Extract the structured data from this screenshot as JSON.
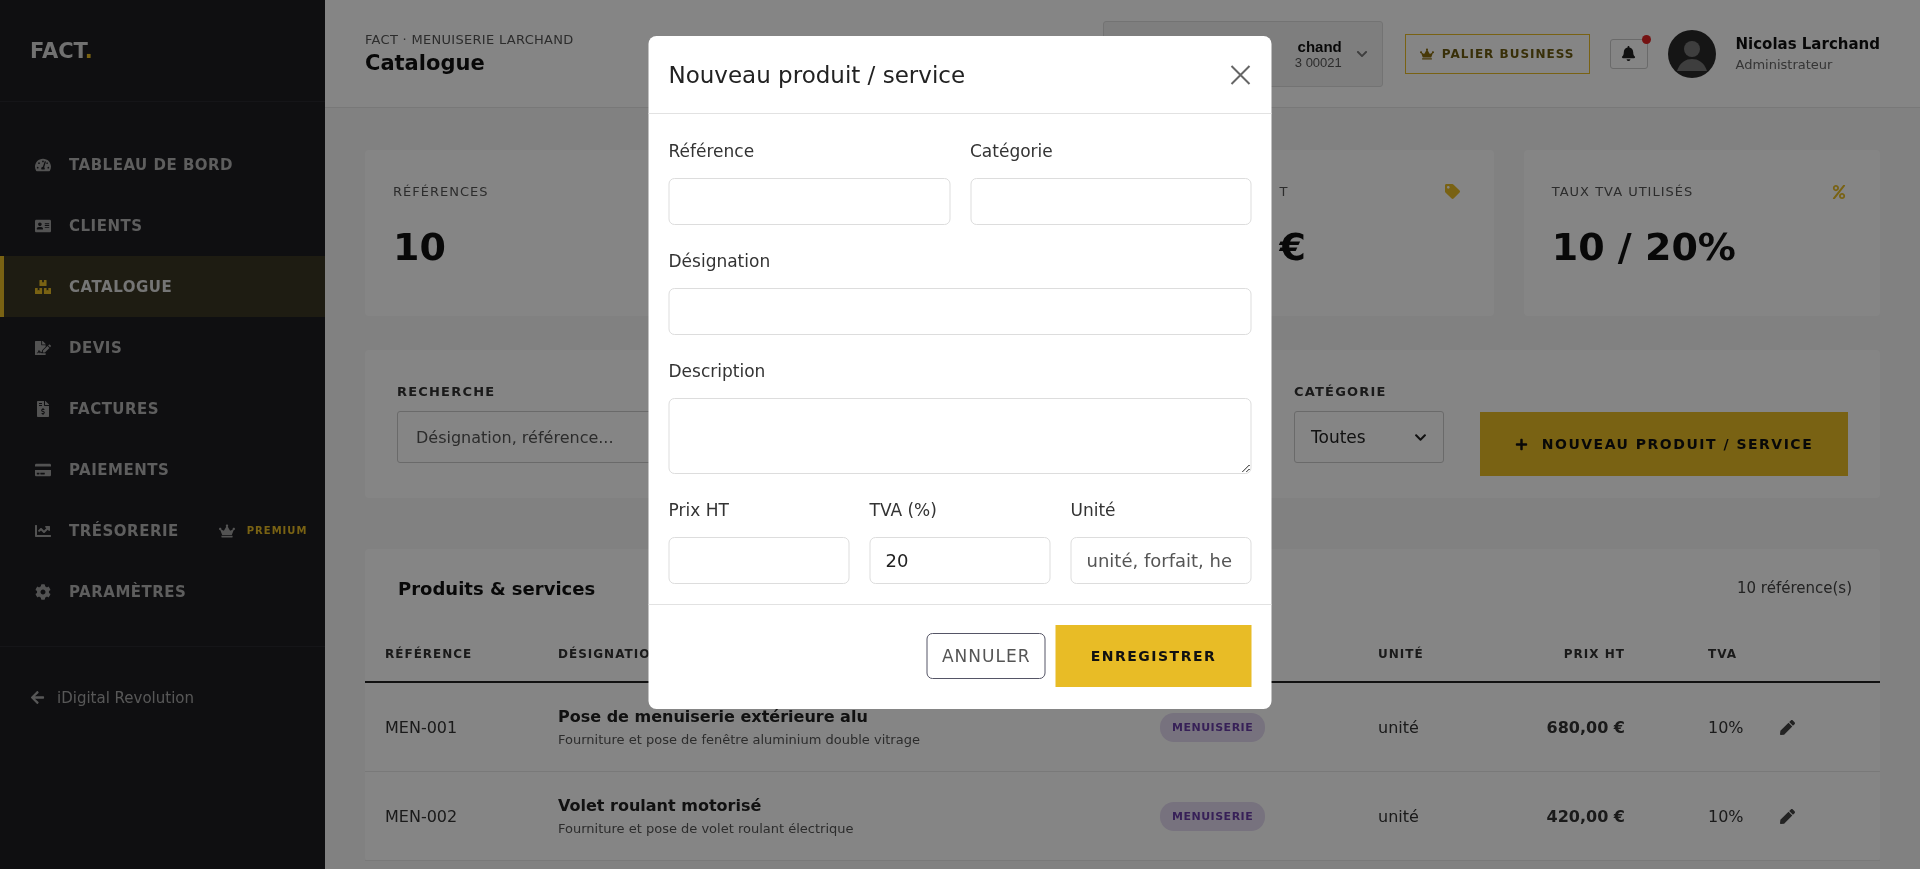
{
  "sidebar": {
    "logo": {
      "text": "FACT",
      "accent": "."
    },
    "items": [
      {
        "label": "TABLEAU DE BORD",
        "selected": false
      },
      {
        "label": "CLIENTS",
        "selected": false
      },
      {
        "label": "CATALOGUE",
        "selected": true
      },
      {
        "label": "DEVIS",
        "selected": false
      },
      {
        "label": "FACTURES",
        "selected": false
      },
      {
        "label": "PAIEMENTS",
        "selected": false
      },
      {
        "label": "TRÉSORERIE",
        "selected": false,
        "badge": "PREMIUM"
      },
      {
        "label": "PARAMÈTRES",
        "selected": false
      }
    ],
    "footer_link": "iDigital Revolution"
  },
  "header": {
    "breadcrumb": "FACT · MENUISERIE LARCHAND",
    "title": "Catalogue",
    "company_selector": {
      "name": "chand",
      "number": "3 00021"
    },
    "plan_badge": "PALIER BUSINESS",
    "notifications": {
      "unread": true
    },
    "user": {
      "name": "Nicolas Larchand",
      "role": "Administrateur"
    }
  },
  "stats": [
    {
      "kind": "plain",
      "label": "RÉFÉRENCES",
      "value": "10"
    },
    {
      "kind": "tagged",
      "label": "T",
      "value": "€"
    },
    {
      "kind": "rate",
      "label": "TAUX TVA UTILISÉS",
      "value": "10 / 20%"
    }
  ],
  "filters": {
    "search": {
      "label": "RECHERCHE",
      "placeholder": "Désignation, référence..."
    },
    "category": {
      "label": "CATÉGORIE",
      "value": "Toutes"
    },
    "new_button": "NOUVEAU PRODUIT / SERVICE"
  },
  "table": {
    "title": "Produits & services",
    "count": "10 référence(s)",
    "columns": [
      "RÉFÉRENCE",
      "DÉSIGNATIO",
      "UNITÉ",
      "PRIX HT",
      "TVA"
    ],
    "rows": [
      {
        "reference": "MEN-001",
        "title": "Pose de menuiserie extérieure alu",
        "description": "Fourniture et pose de fenêtre aluminium double vitrage",
        "category": "MENUISERIE",
        "unit": "unité",
        "price": "680,00 €",
        "vat": "10%"
      },
      {
        "reference": "MEN-002",
        "title": "Volet roulant motorisé",
        "description": "Fourniture et pose de volet roulant électrique",
        "category": "MENUISERIE",
        "unit": "unité",
        "price": "420,00 €",
        "vat": "10%"
      }
    ]
  },
  "modal": {
    "title": "Nouveau produit / service",
    "rows": [
      {
        "fields": [
          {
            "kind": "input",
            "label": "Référence"
          },
          {
            "kind": "input",
            "label": "Catégorie"
          }
        ]
      },
      {
        "fields": [
          {
            "kind": "input",
            "label": "Désignation"
          }
        ]
      },
      {
        "fields": [
          {
            "kind": "textarea",
            "label": "Description"
          }
        ]
      },
      {
        "fields": [
          {
            "kind": "input",
            "label": "Prix HT"
          },
          {
            "kind": "input",
            "label": "TVA (%)",
            "value": "20"
          },
          {
            "kind": "input",
            "label": "Unité",
            "placeholder": "unité, forfait, he"
          }
        ]
      }
    ],
    "buttons": {
      "cancel": "ANNULER",
      "save": "ENREGISTRER"
    }
  }
}
